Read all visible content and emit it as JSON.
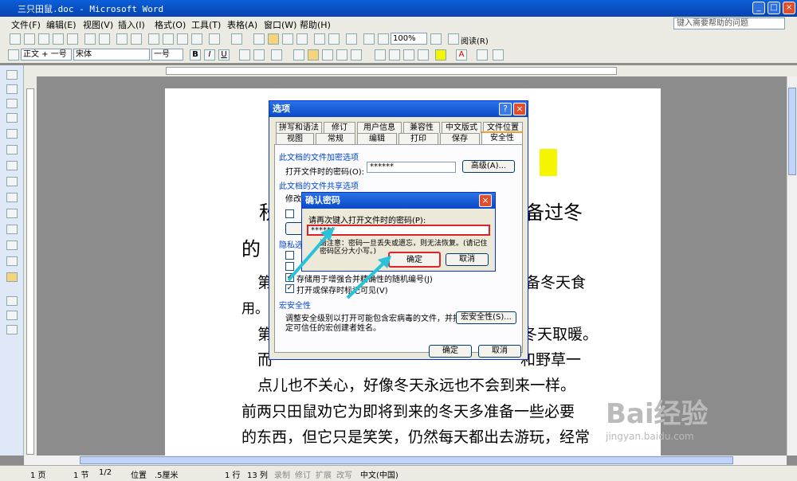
{
  "window": {
    "title": "三只田鼠.doc - Microsoft Word",
    "help_placeholder": "键入需要帮助的问题"
  },
  "menu": [
    "文件(F)",
    "编辑(E)",
    "视图(V)",
    "插入(I)",
    "格式(O)",
    "工具(T)",
    "表格(A)",
    "窗口(W)",
    "帮助(H)"
  ],
  "toolbar": {
    "zoom": "100%",
    "read_label": "阅读(R)",
    "style": "正文 + 一号",
    "font": "宋体",
    "size": "一号"
  },
  "doc": {
    "lines": [
      "秋",
      "备过冬",
      "的",
      "第",
      "备冬天食",
      "用。",
      "第",
      "冬天取暖。",
      "而",
      "和野草一",
      "点儿也不关心，好像冬天永远也不会到来一样。",
      "前两只田鼠劝它为即将到来的冬天多准备一些必要",
      "的东西，但它只是笑笑，仍然每天都出去游玩，经常"
    ]
  },
  "options_dialog": {
    "title": "选项",
    "tabs_row1": [
      "拼写和语法",
      "修订",
      "用户信息",
      "兼容性",
      "中文版式",
      "文件位置"
    ],
    "tabs_row2": [
      "视图",
      "常规",
      "编辑",
      "打印",
      "保存",
      "安全性"
    ],
    "encrypt_section": "此文档的文件加密选项",
    "open_pwd_label": "打开文件时的密码(O):",
    "open_pwd_value": "******",
    "advanced": "高级(A)...",
    "share_section": "此文档的文件共享选项",
    "modify": "修改",
    "privacy_section": "隐私选",
    "cb_random": "存储用于增强合并精确性的随机编号(J)",
    "cb_markup": "打开或保存时标记可见(V)",
    "macro_section": "宏安全性",
    "macro_text1": "调整安全级别以打开可能包含宏病毒的文件，并指",
    "macro_text2": "定可信任的宏创建者姓名。",
    "macro_btn": "宏安全性(S)...",
    "ok": "确定",
    "cancel": "取消"
  },
  "confirm_dialog": {
    "title": "确认密码",
    "prompt": "请再次键入打开文件时的密码(P):",
    "value": "******",
    "warn1": "请注意：密码一旦丢失或遗忘，则无法恢复。(请记住",
    "warn2": "密码区分大小写。)",
    "ok": "确定",
    "cancel": "取消"
  },
  "status": {
    "page": "1 页",
    "section": "1 节",
    "pages": "1/2",
    "pos": "位置",
    "pos_val": ".5厘米",
    "row": "1 行",
    "col": "13 列",
    "rec": "录制",
    "trk": "修订",
    "ext": "扩展",
    "ovr": "改写",
    "lang": "中文(中国)"
  },
  "watermark": {
    "text": "Bai经验",
    "url": "jingyan.baidu.com"
  },
  "colors": {
    "highlight": "#f5f500",
    "red_box": "#e0202a",
    "arrow": "#27c3d8"
  }
}
